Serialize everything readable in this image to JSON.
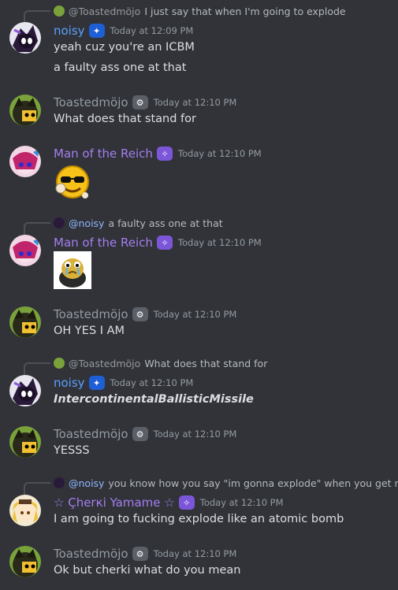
{
  "colors": {
    "background": "#313338",
    "text": "#dbdee1",
    "muted": "#949ba4",
    "noisy": "#5ca0ff",
    "reich": "#a57ef0"
  },
  "messages": [
    {
      "reply_to": "@Toastedmöjo",
      "reply_text": "I just say that when I'm going to explode",
      "author": "noisy",
      "time": "Today at 12:09 PM",
      "lines": [
        "yeah cuz you're an ICBM",
        "a faulty ass one at that"
      ]
    },
    {
      "author": "Toastedmöjo",
      "time": "Today at 12:10 PM",
      "lines": [
        "What does that stand for"
      ]
    },
    {
      "author": "Man of the Reich",
      "time": "Today at 12:10 PM",
      "emote": "sunglasses-smiley-emote"
    },
    {
      "reply_to": "@noisy",
      "reply_text": "a faulty ass one at that",
      "author": "Man of the Reich",
      "time": "Today at 12:10 PM",
      "emote": "crying-frog-emote"
    },
    {
      "author": "Toastedmöjo",
      "time": "Today at 12:10 PM",
      "lines": [
        "OH YES I AM"
      ]
    },
    {
      "reply_to": "@Toastedmöjo",
      "reply_text": "What does that stand for",
      "author": "noisy",
      "time": "Today at 12:10 PM",
      "lines": [
        "IntercontinentalBallisticMissile"
      ]
    },
    {
      "author": "Toastedmöjo",
      "time": "Today at 12:10 PM",
      "lines": [
        "YESSS"
      ]
    },
    {
      "reply_to": "@noisy",
      "reply_text": "you know how you say \"im gonna explode\" when you get mad",
      "author": "☆ Çherкi Yamame ☆",
      "time": "Today at 12:10 PM",
      "lines": [
        "I am going to fucking explode like an atomic bomb"
      ]
    },
    {
      "author": "Toastedmöjo",
      "time": "Today at 12:10 PM",
      "lines": [
        "Ok but cherki what do you mean"
      ]
    }
  ]
}
